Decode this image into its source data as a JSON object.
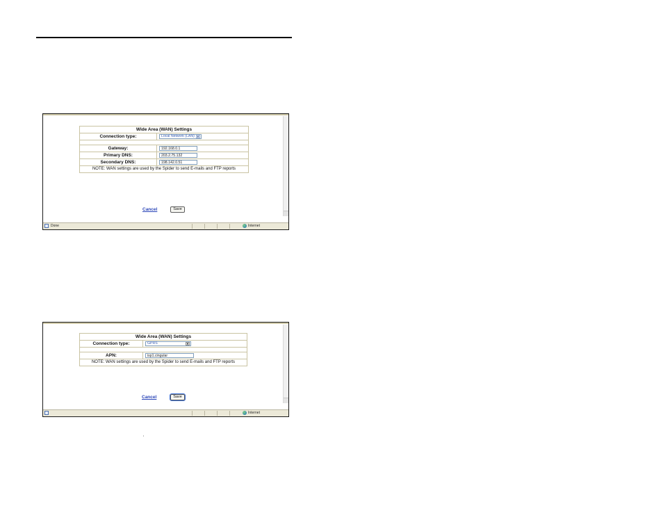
{
  "screenshot1": {
    "table": {
      "title": "Wide Area (WAN) Settings",
      "connection_label": "Connection type:",
      "connection_value": "Local Network (LAN)",
      "rows": [
        {
          "label": "Gateway:",
          "value": "192.168.0.1"
        },
        {
          "label": "Primary DNS:",
          "value": "203.2.75.132"
        },
        {
          "label": "Secondary DNS:",
          "value": "198.142.0.51"
        }
      ],
      "note": "NOTE: WAN settings are used by the Spider to send E-mails and FTP reports"
    },
    "cancel_label": "Cancel",
    "save_label": "Save",
    "status": {
      "text": "Done",
      "zone": "Internet"
    }
  },
  "screenshot2": {
    "table": {
      "title": "Wide Area (WAN) Settings",
      "connection_label": "Connection type:",
      "connection_value": "GPRS",
      "apn_label": "APN:",
      "apn_value": "isp1.cingular",
      "note": "NOTE: WAN settings are used by the Spider to send E-mails and FTP reports"
    },
    "cancel_label": "Cancel",
    "save_label": "Save",
    "status": {
      "zone": "Internet"
    }
  },
  "stray_mark": "'",
  "colors": {
    "link": "#2a45b8",
    "table_border": "#c9c3a2",
    "status_bar": "#ece9d8"
  }
}
